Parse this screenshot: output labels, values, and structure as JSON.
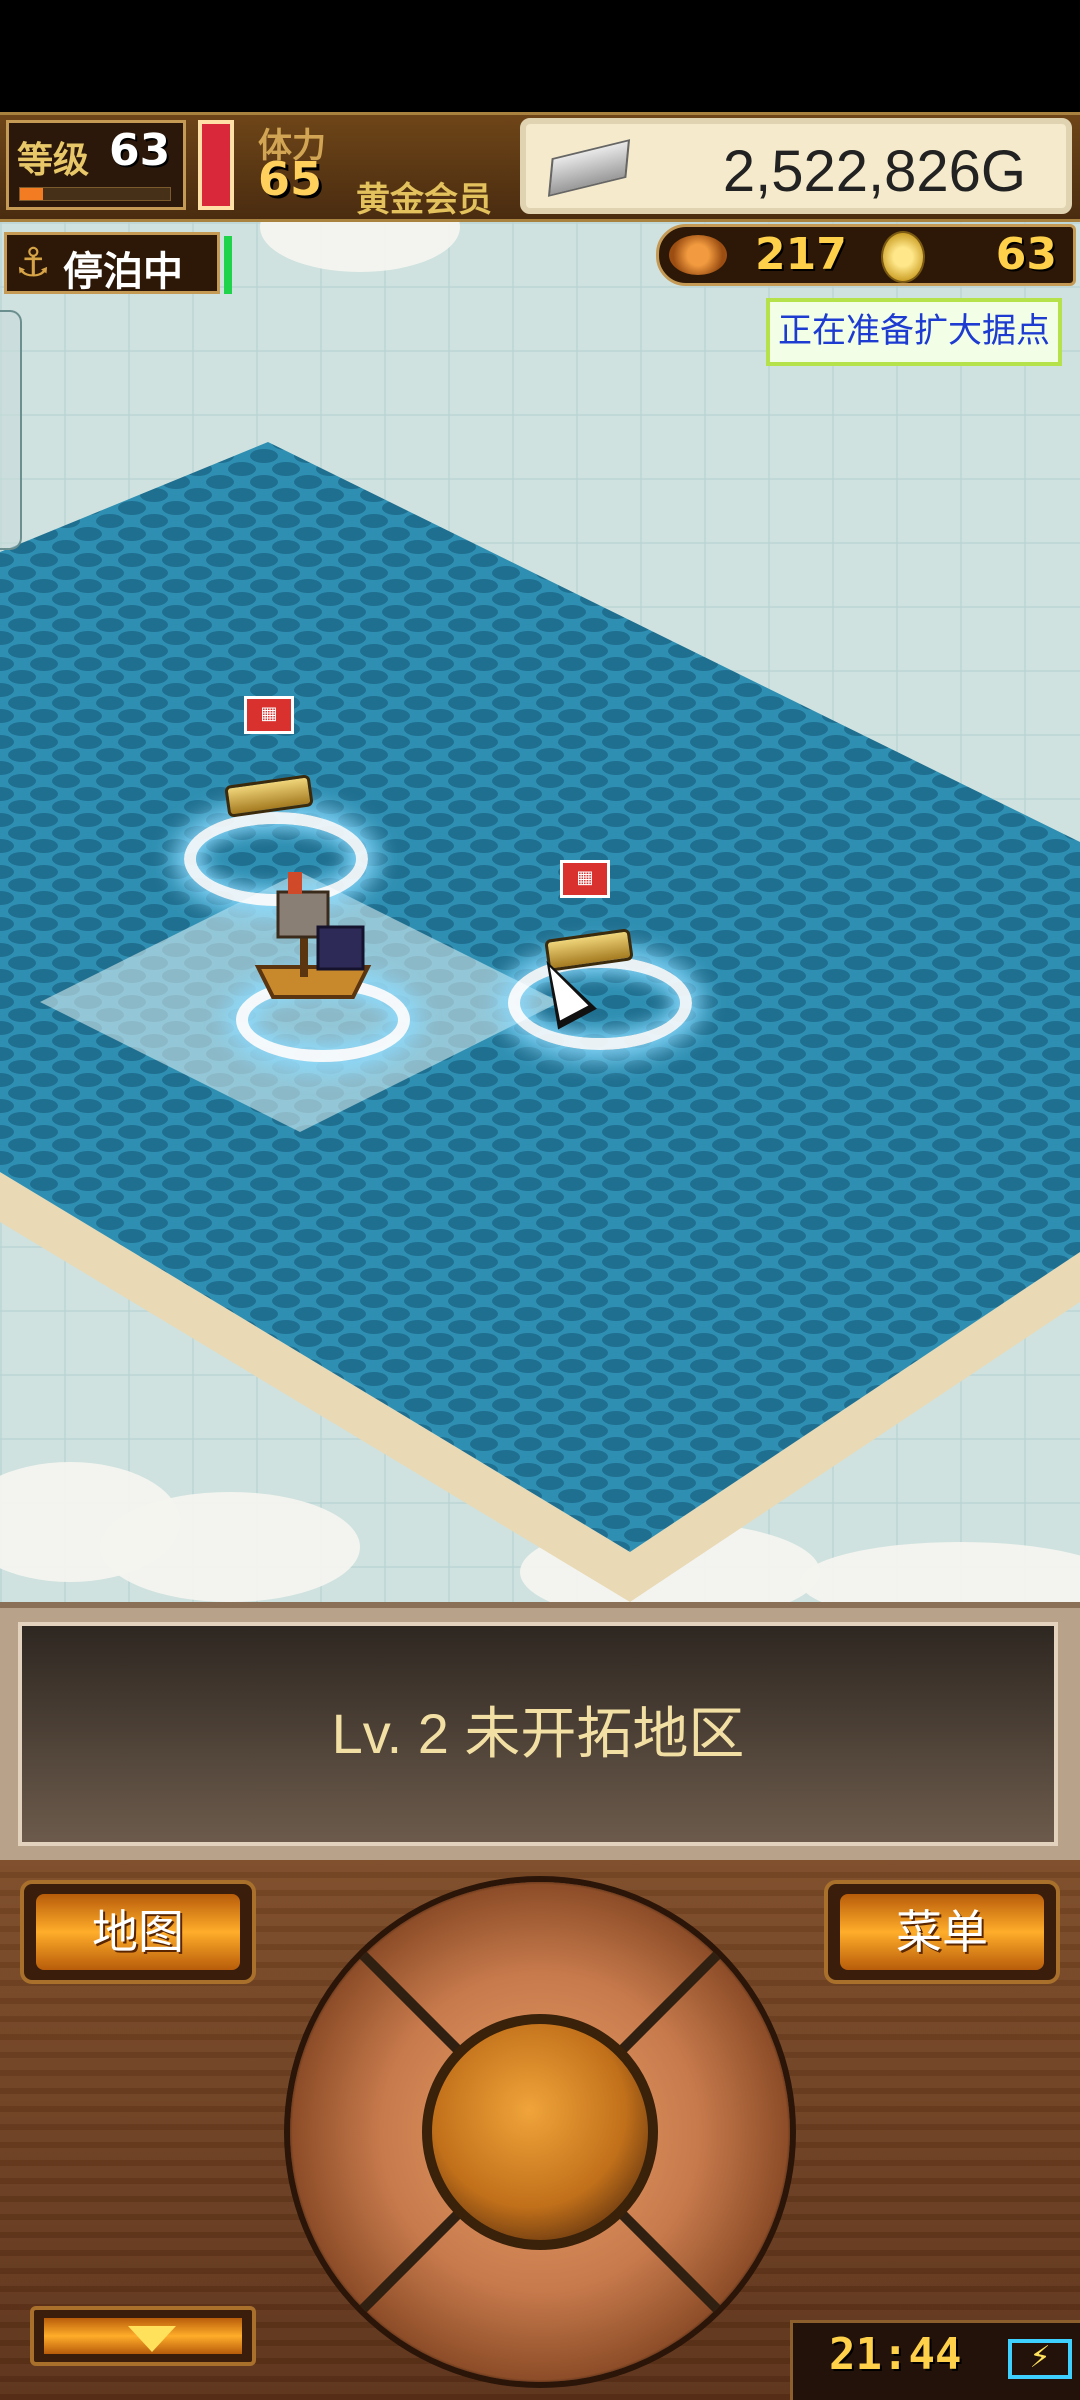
{
  "hud": {
    "level_label": "等级",
    "level_value": "63",
    "level_progress": 0.15,
    "stamina_label": "体力",
    "stamina_value": "65",
    "member_label": "黄金会员",
    "gold_value": "2,522,826G"
  },
  "status": {
    "dock_label": "停泊中",
    "fish_value": "217",
    "coin_value": "63",
    "expand_notice": "正在准备扩大据点"
  },
  "message": {
    "text": "Lv. 2 未开拓地区"
  },
  "controls": {
    "map_label": "地图",
    "menu_label": "菜单",
    "clock": "21:44"
  },
  "colors": {
    "sea": "#2f8fb2",
    "sea_dark": "#1f6f90",
    "sand": "#e9d9b5",
    "gold_text": "#ffd04a",
    "notice_text": "#1d3bd0"
  },
  "icons": {
    "anchor": "anchor-icon",
    "fish": "fish-icon",
    "coin": "coin-icon",
    "battery": "battery-charging-icon",
    "collapse": "triangle-down-icon"
  }
}
